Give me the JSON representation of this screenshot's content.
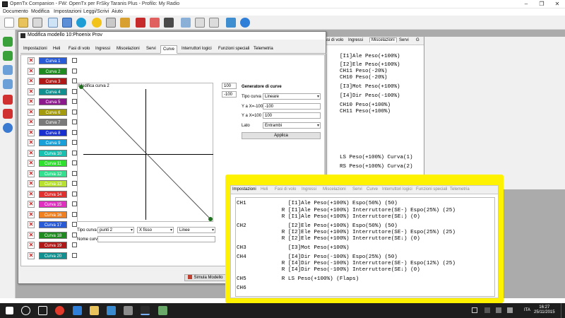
{
  "window": {
    "title": "OpenTx Companion - FW: OpenTx per FrSky Taranis Plus - Profilo: My Radio",
    "menu": [
      "Documento",
      "Modifica",
      "Impostazioni",
      "Leggi/Scrivi",
      "Aiuto"
    ]
  },
  "right_panel": {
    "tabs": [
      "ssi di volo",
      "Ingressi",
      "Miscelazioni",
      "Servi",
      "G"
    ],
    "active_tab": "Miscelazioni",
    "lines": [
      "[I1]Ale Peso(+100%)",
      "[I2]Ele Peso(+100%)",
      "CH11 Peso(-20%)",
      "CH10 Peso(-20%)",
      "[I3]Mot Peso(+100%)",
      "[I4]Dir Peso(-100%)",
      "CH10 Peso(+100%)",
      "CH11 Peso(+100%)",
      "LS Peso(+100%) Curva(1)",
      "RS Peso(+100%) Curva(2)"
    ]
  },
  "dialog": {
    "title": "Modifica modello 10:Phoenix Prov",
    "tabs": [
      "Impostazioni",
      "Heli",
      "Fasi di volo",
      "Ingressi",
      "Miscelazioni",
      "Servi",
      "Curve",
      "Interruttori logici",
      "Funzioni speciali",
      "Telemetria"
    ],
    "active_tab": "Curve",
    "curves": [
      {
        "label": "Curva 1",
        "color": "#2a5bd7"
      },
      {
        "label": "Curva 2",
        "color": "#1f8a1f"
      },
      {
        "label": "Curva 3",
        "color": "#b01717"
      },
      {
        "label": "Curva 4",
        "color": "#129090"
      },
      {
        "label": "Curva 5",
        "color": "#8c1a8c"
      },
      {
        "label": "Curva 6",
        "color": "#a39a10"
      },
      {
        "label": "Curva 7",
        "color": "#7a7a7a"
      },
      {
        "label": "Curva 8",
        "color": "#1a2fd0"
      },
      {
        "label": "Curva 9",
        "color": "#1aa0d8"
      },
      {
        "label": "Curva 10",
        "color": "#19c0b0"
      },
      {
        "label": "Curva 11",
        "color": "#2fe02f"
      },
      {
        "label": "Curva 12",
        "color": "#34e090"
      },
      {
        "label": "Curva 13",
        "color": "#b8e030"
      },
      {
        "label": "Curva 14",
        "color": "#e03030"
      },
      {
        "label": "Curva 15",
        "color": "#e030c0"
      },
      {
        "label": "Curva 16",
        "color": "#f08020"
      },
      {
        "label": "Curva 17",
        "color": "#2a5bd7"
      },
      {
        "label": "Curva 18",
        "color": "#1f8a1f"
      },
      {
        "label": "Curva 19",
        "color": "#b01717"
      },
      {
        "label": "Curva 20",
        "color": "#129090"
      }
    ],
    "graph_title": "Modifica curva 2",
    "spin_top": "100",
    "spin_bottom": "-100",
    "curve_type_label": "Tipo curva",
    "curve_type_value": "punti 2",
    "x_mode_value": "X fisso",
    "line_mode_value": "Linee",
    "curve_name_label": "Nome curva",
    "curve_name_value": "",
    "generator": {
      "title": "Generatore di curve",
      "type_label": "Tipo curva",
      "type_value": "Lineare",
      "y_at_minus_label": "Y a X=-100",
      "y_at_minus_value": "-100",
      "y_at_plus_label": "Y a X=100",
      "y_at_plus_value": "100",
      "side_label": "Lato",
      "side_value": "Entrambi",
      "apply_label": "Applica"
    },
    "simulate_label": "Simula Modello"
  },
  "popup": {
    "tabs": [
      "Impostazioni",
      "Heli",
      "Fasi di volo",
      "Ingressi",
      "Miscelazioni",
      "Servi",
      "Curve",
      "Interruttori logici",
      "Funzioni speciali",
      "Telemetria"
    ],
    "lines": [
      "CH1             [I1]Ale Peso(+100%) Espo(50%) (50)",
      "              R [I1]Ale Peso(+100%) Interruttore(SE-) Espo(25%) (25)",
      "              R [I1]Ale Peso(+100%) Interruttore(SE↓) (0)",
      "CH2             [I2]Ele Peso(+100%) Espo(50%) (50)",
      "              R [I2]Ele Peso(+100%) Interruttore(SE-) Espo(25%) (25)",
      "              R [I2]Ele Peso(+100%) Interruttore(SE↓) (0)",
      "CH3             [I3]Mot Peso(+100%)",
      "CH4             [I4]Dir Peso(-100%) Espo(25%) (50)",
      "              R [I4]Dir Peso(-100%) Interruttore(SE-) Espo(12%) (25)",
      "              R [I4]Dir Peso(-100%) Interruttore(SE↓) (0)",
      "CH5           R LS Peso(+100%) (Flaps)",
      "CH6"
    ]
  },
  "taskbar": {
    "language": "ITA",
    "time": "16:27",
    "date": "25/11/2015"
  }
}
